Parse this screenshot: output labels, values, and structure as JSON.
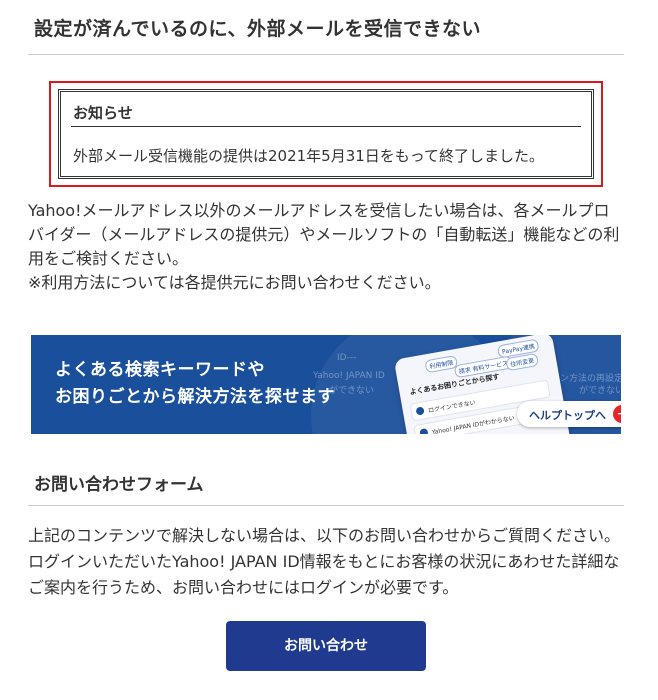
{
  "page": {
    "title": "設定が済んでいるのに、外部メールを受信できない"
  },
  "notice": {
    "heading": "お知らせ",
    "body": "外部メール受信機能の提供は2021年5月31日をもって終了しました。"
  },
  "intro": {
    "lines": [
      "Yahoo!メールアドレス以外のメールアドレスを受信したい場合は、各メールプロ",
      "バイダー（メールアドレスの提供元）やメールソフトの「自動転送」機能などの利",
      "用をご検討ください。",
      "※利用方法については各提供元にお問い合わせください。"
    ]
  },
  "banner": {
    "headline_line1": "よくある検索キーワードや",
    "headline_line2": "お困りごとから解決方法を探せます",
    "button_label": "ヘルプトップへ",
    "phone_heading": "よくあるお困りごとから探す",
    "phone_items": [
      "ログインできない",
      "Yahoo! JAPAN IDがわからない"
    ],
    "phone_tags": [
      "利用制限",
      "請求 有料サービス",
      "PayPay連携",
      "住所変更"
    ],
    "ghost_texts": [
      "ID---",
      "Yahoo! JAPAN ID",
      "ができない",
      "イン方法の再設定」",
      "ができない"
    ],
    "colors": {
      "background": "#1a4f9c",
      "button_icon": "#e8242b"
    }
  },
  "contact": {
    "section_title": "お問い合わせフォーム",
    "description": "上記のコンテンツで解決しない場合は、以下のお問い合わせからご質問ください。ログインいただいたYahoo! JAPAN ID情報をもとにお客様の状況にあわせた詳細なご案内を行うため、お問い合わせにはログインが必要です。",
    "button_label": "お問い合わせ",
    "colors": {
      "button": "#1f3a8f"
    }
  },
  "colors": {
    "notice_highlight": "#e0161c",
    "text": "#333333"
  }
}
